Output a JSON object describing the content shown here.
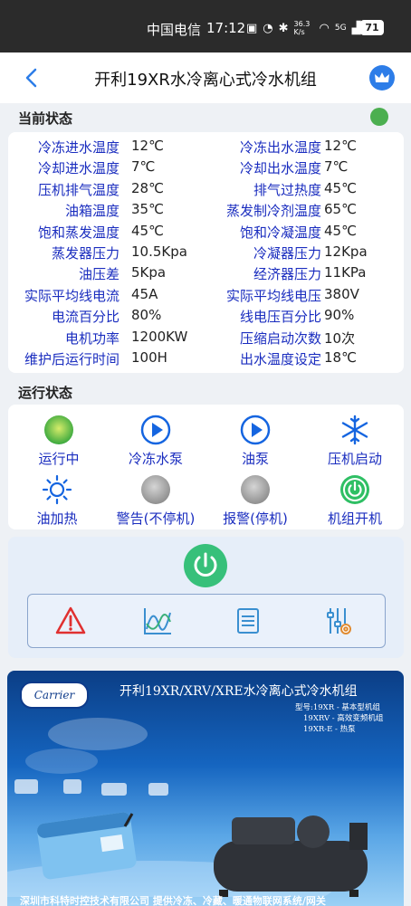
{
  "status_bar": {
    "carrier": "中国电信",
    "time": "17:12",
    "network_speed": "36.3 K/s",
    "signal": "5G",
    "battery": "71"
  },
  "app_bar": {
    "title": "开利19XR水冷离心式冷水机组"
  },
  "current_status": {
    "label": "当前状态",
    "indicator_color": "#4caf50",
    "params": [
      {
        "l1": "冷冻进水温度",
        "v1": "12℃",
        "l2": "冷冻出水温度",
        "v2": "12℃"
      },
      {
        "l1": "冷却进水温度",
        "v1": "7℃",
        "l2": "冷却出水温度",
        "v2": "7℃"
      },
      {
        "l1": "压机排气温度",
        "v1": "28℃",
        "l2": "排气过热度",
        "v2": "45℃"
      },
      {
        "l1": "油箱温度",
        "v1": "35℃",
        "l2": "蒸发制冷剂温度",
        "v2": "65℃"
      },
      {
        "l1": "饱和蒸发温度",
        "v1": "45℃",
        "l2": "饱和冷凝温度",
        "v2": "45℃"
      },
      {
        "l1": "蒸发器压力",
        "v1": "10.5Kpa",
        "l2": "冷凝器压力",
        "v2": "12Kpa"
      },
      {
        "l1": "油压差",
        "v1": "5Kpa",
        "l2": "经济器压力",
        "v2": "11KPa"
      },
      {
        "l1": "实际平均线电流",
        "v1": "45A",
        "l2": "实际平均线电压",
        "v2": "380V"
      },
      {
        "l1": "电流百分比",
        "v1": "80%",
        "l2": "线电压百分比",
        "v2": "90%"
      },
      {
        "l1": "电机功率",
        "v1": "1200KW",
        "l2": "压缩启动次数",
        "v2": "10次"
      },
      {
        "l1": "维护后运行时间",
        "v1": "100H",
        "l2": "出水温度设定",
        "v2": "18℃"
      }
    ]
  },
  "run_status": {
    "label": "运行状态",
    "items": [
      {
        "label": "运行中",
        "icon": "running-dot-icon"
      },
      {
        "label": "冷冻水泵",
        "icon": "play-circle-icon"
      },
      {
        "label": "油泵",
        "icon": "play-circle-icon"
      },
      {
        "label": "压机启动",
        "icon": "snowflake-icon"
      },
      {
        "label": "油加热",
        "icon": "sun-icon"
      },
      {
        "label": "警告(不停机)",
        "icon": "gray-dot-icon"
      },
      {
        "label": "报警(停机)",
        "icon": "gray-dot-icon"
      },
      {
        "label": "机组开机",
        "icon": "power-icon"
      }
    ]
  },
  "controls": {
    "power_color": "#37c07a",
    "tools": [
      "alarm-icon",
      "trend-chart-icon",
      "list-icon",
      "settings-sliders-icon"
    ]
  },
  "banner": {
    "brand": "Carrier",
    "title": "开利19XR/XRV/XRE水冷离心式冷水机组",
    "models": [
      "型号:19XR - 基本型机组",
      "19XRV - 高效变频机组",
      "19XR-E - 热泵"
    ],
    "footer": "深圳市科特时控技术有限公司   提供冷冻、冷藏、暖通物联网系统/网关"
  }
}
